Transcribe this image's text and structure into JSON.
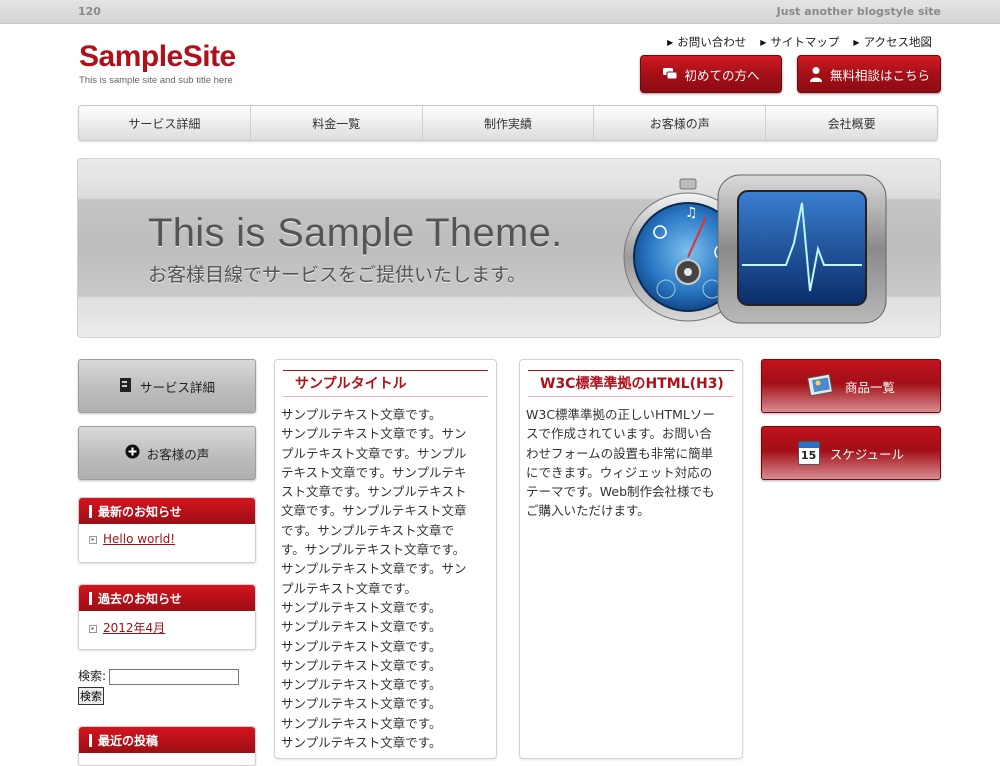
{
  "topbar": {
    "left": "120",
    "right": "Just another blogstyle site"
  },
  "logo": {
    "name": "SampleSite",
    "subtitle": "This is sample site and sub title here"
  },
  "toplinks": [
    "お問い合わせ",
    "サイトマップ",
    "アクセス地図"
  ],
  "header_buttons": {
    "first": "初めての方へ",
    "consult": "無料相談はこちら"
  },
  "nav": [
    "サービス詳細",
    "料金一覧",
    "制作実績",
    "お客様の声",
    "会社概要"
  ],
  "hero": {
    "title": "This is Sample Theme.",
    "subtitle": "お客様目線でサービスをご提供いたします。"
  },
  "left_buttons": {
    "service": "サービス詳細",
    "voice": "お客様の声"
  },
  "widgets": {
    "news": {
      "title": "最新のお知らせ",
      "item": "Hello world!"
    },
    "archive": {
      "title": "過去のお知らせ",
      "item": "2012年4月"
    },
    "recent": {
      "title": "最近の投稿"
    }
  },
  "search": {
    "label": "検索:",
    "button": "検索",
    "value": ""
  },
  "sample": {
    "title": "サンプルタイトル",
    "lines": [
      "サンプルテキスト文章です。",
      "サンプルテキスト文章です。サン",
      "プルテキスト文章です。サンプル",
      "テキスト文章です。サンプルテキ",
      "スト文章です。サンプルテキスト",
      "文章です。サンプルテキスト文章",
      "です。サンプルテキスト文章で",
      "す。サンプルテキスト文章です。",
      "サンプルテキスト文章です。サン",
      "プルテキスト文章です。",
      "サンプルテキスト文章です。",
      "サンプルテキスト文章です。",
      "サンプルテキスト文章です。",
      "サンプルテキスト文章です。",
      "サンプルテキスト文章です。",
      "サンプルテキスト文章です。",
      "サンプルテキスト文章です。",
      "サンプルテキスト文章です。"
    ]
  },
  "w3c": {
    "title": "W3C標準準拠のHTML(H3)",
    "lines": [
      "W3C標準準拠の正しいHTMLソー",
      "スで作成されています。お問い合",
      "わせフォームの設置も非常に簡単",
      "にできます。ウィジェット対応の",
      "テーマです。Web制作会社様でも",
      "ご購入いただけます。"
    ]
  },
  "right_buttons": {
    "products": "商品一覧",
    "schedule": "スケジュール",
    "calendar_day": "15"
  },
  "colors": {
    "accent": "#b0101a",
    "button_red": "#a20f17"
  }
}
